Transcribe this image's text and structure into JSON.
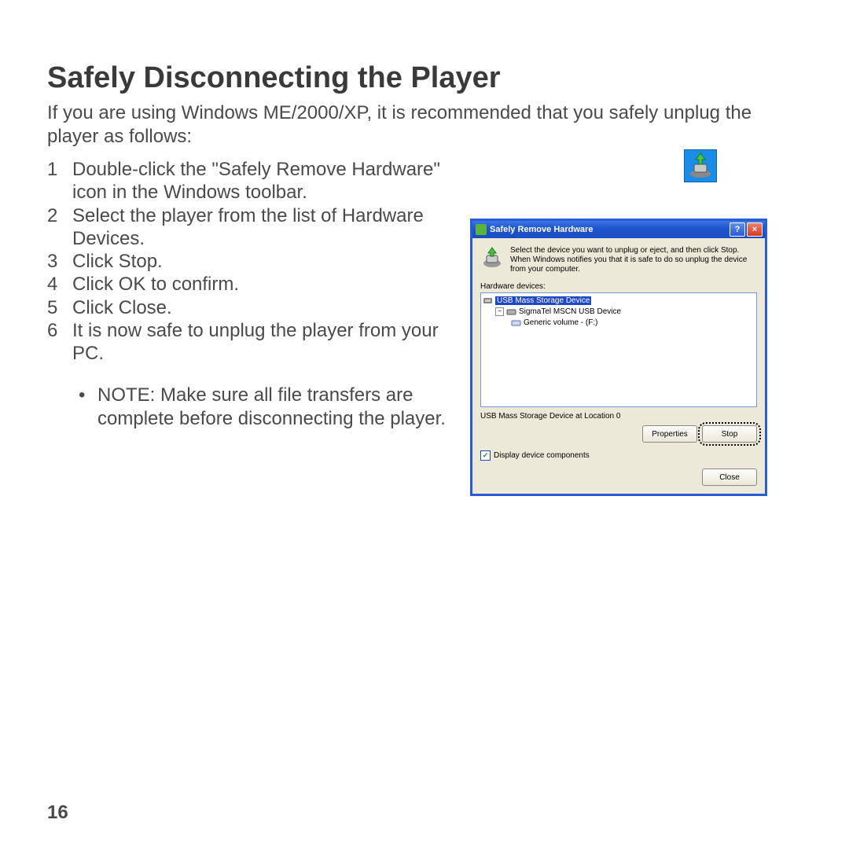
{
  "title": "Safely Disconnecting the Player",
  "intro": "If you are using Windows ME/2000/XP, it is recommended that you safely unplug the player as follows:",
  "steps": [
    {
      "n": "1",
      "t": "Double-click the \"Safely Remove Hardware\" icon in the Windows toolbar."
    },
    {
      "n": "2",
      "t": "Select the player from the list of Hardware Devices."
    },
    {
      "n": "3",
      "t": "Click Stop."
    },
    {
      "n": "4",
      "t": "Click OK to confirm."
    },
    {
      "n": "5",
      "t": "Click Close."
    },
    {
      "n": "6",
      "t": "It is now safe to unplug the player from your PC."
    }
  ],
  "note_label": "NOTE: Make sure all file transfers are complete before disconnecting the player.",
  "page_number": "16",
  "tray_icon_name": "safely-remove-hardware-icon",
  "dialog": {
    "title": "Safely Remove Hardware",
    "info_text": "Select the device you want to unplug or eject, and then click Stop. When Windows notifies you that it is safe to do so unplug the device from your computer.",
    "hw_label": "Hardware devices:",
    "tree": {
      "root": "USB Mass Storage Device",
      "child1": "SigmaTel MSCN USB Device",
      "child2": "Generic volume - (F:)"
    },
    "status": "USB Mass Storage Device at Location 0",
    "buttons": {
      "properties": "Properties",
      "stop": "Stop",
      "close": "Close"
    },
    "checkbox_label": "Display device components"
  }
}
